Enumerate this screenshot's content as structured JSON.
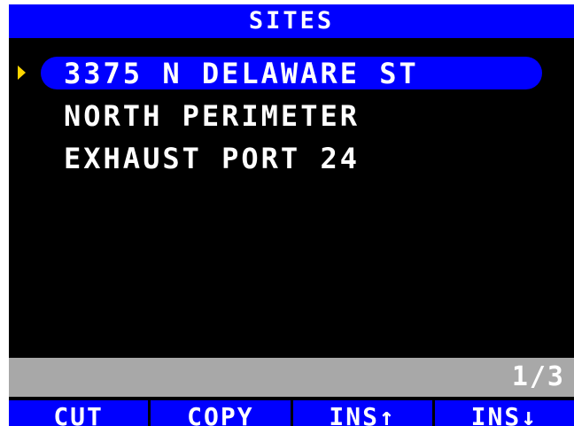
{
  "title": "SITES",
  "sites": [
    {
      "label": "3375 N DELAWARE ST",
      "selected": true
    },
    {
      "label": "NORTH PERIMETER",
      "selected": false
    },
    {
      "label": "EXHAUST PORT 24",
      "selected": false
    }
  ],
  "page_indicator": "1/3",
  "softkeys": [
    {
      "label": "CUT"
    },
    {
      "label": "COPY"
    },
    {
      "label": "INS↑"
    },
    {
      "label": "INS↓"
    }
  ],
  "colors": {
    "title_bar": "#0000ff",
    "selection": "#0000ff",
    "selector_arrow": "#ffd600",
    "status_bar": "#a8a8a8",
    "background": "#000000"
  },
  "icons": {
    "selector": "selector-arrow-icon"
  }
}
